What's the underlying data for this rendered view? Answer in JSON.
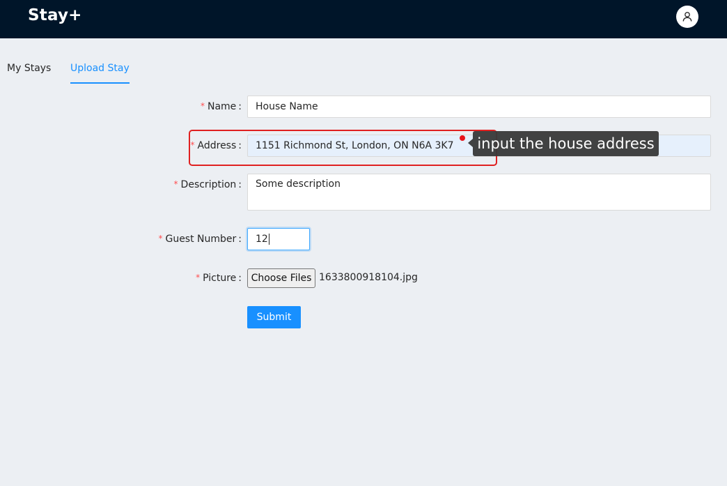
{
  "header": {
    "logo": "Stay+",
    "avatar_icon": "user-icon",
    "background": "#001529"
  },
  "tabs": [
    {
      "label": "My Stays",
      "active": false
    },
    {
      "label": "Upload Stay",
      "active": true
    }
  ],
  "form": {
    "required_mark": "*",
    "colon": ":",
    "name": {
      "label": "Name",
      "value": "House Name"
    },
    "address": {
      "label": "Address",
      "value": "1151 Richmond St, London, ON N6A 3K7"
    },
    "description": {
      "label": "Description",
      "value": "Some description"
    },
    "guest_number": {
      "label": "Guest Number",
      "value": "12"
    },
    "picture": {
      "label": "Picture",
      "button_label": "Choose Files",
      "file_name": "1633800918104.jpg"
    },
    "submit_label": "Submit"
  },
  "annotation": {
    "tooltip": "input the house address",
    "box_color": "#e02020"
  },
  "colors": {
    "accent": "#1890ff",
    "required": "#ff4d4f",
    "page_background": "#eceff3"
  }
}
